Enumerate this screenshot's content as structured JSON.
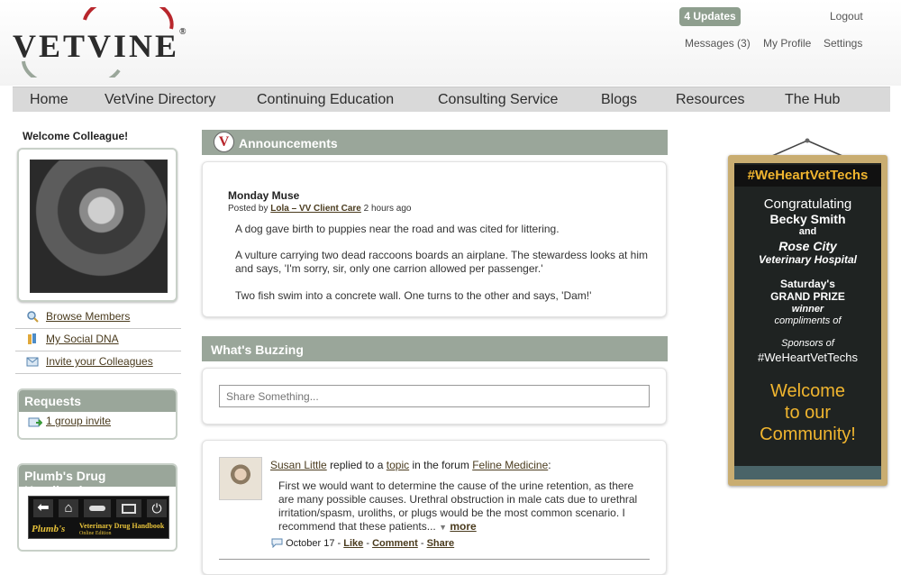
{
  "header": {
    "logo_text": "VETVINE",
    "updates_badge": "4 Updates",
    "logout": "Logout",
    "messages": "Messages (3)",
    "my_profile": "My Profile",
    "settings": "Settings"
  },
  "nav": [
    "Home",
    "VetVine Directory",
    "Continuing Education",
    "Consulting Service",
    "Blogs",
    "Resources",
    "The Hub"
  ],
  "sidebar": {
    "welcome": "Welcome Colleague!",
    "links": [
      "Browse Members",
      "My Social DNA",
      "Invite your Colleagues"
    ],
    "requests_title": "Requests",
    "group_invite": "1 group invite",
    "plumbs_title": "Plumb's Drug Handbook",
    "plumbs_brand": "Plumb's",
    "plumbs_sub": "Veterinary Drug Handbook",
    "plumbs_edition": "Online Edition"
  },
  "announcements": {
    "title": "Announcements",
    "post_title": "Monday Muse",
    "posted_by": "Posted by",
    "author": "Lola – VV Client Care",
    "time": "2 hours ago",
    "paragraphs": [
      "A dog gave birth to puppies near the road and was cited for littering.",
      "A vulture carrying two dead raccoons boards an airplane. The stewardess looks at him and says, 'I'm sorry, sir, only one carrion allowed per passenger.'",
      "Two fish swim into a concrete wall. One turns to the other and says, 'Dam!'"
    ]
  },
  "buzzing": {
    "title": "What's Buzzing",
    "share_placeholder": "Share Something...",
    "post": {
      "author": "Susan Little",
      "replied_to": "replied to a",
      "topic": "topic",
      "in_forum": "in the forum",
      "forum": "Feline Medicine",
      "text": "First we would want to determine the cause of the urine retention, as there are many possible causes. Urethral obstruction in male cats due to urethral irritation/spasm, uroliths, or plugs would be the most common scenario. I recommend that these patients...",
      "more": "more",
      "date": "October 17",
      "like": "Like",
      "comment": "Comment",
      "share": "Share"
    }
  },
  "banner": {
    "hashtag": "#WeHeartVetTechs",
    "congrats": "Congratulating",
    "name": "Becky Smith",
    "and": "and",
    "clinic1": "Rose City",
    "clinic2": "Veterinary Hospital",
    "saturday": "Saturday's",
    "prize": "GRAND PRIZE",
    "winner": "winner",
    "compliments": "compliments of",
    "sponsors": "Sponsors of",
    "hashtag2": "#WeHeartVetTechs",
    "welcome1": "Welcome",
    "welcome2": "to our",
    "welcome3": "Community!"
  }
}
